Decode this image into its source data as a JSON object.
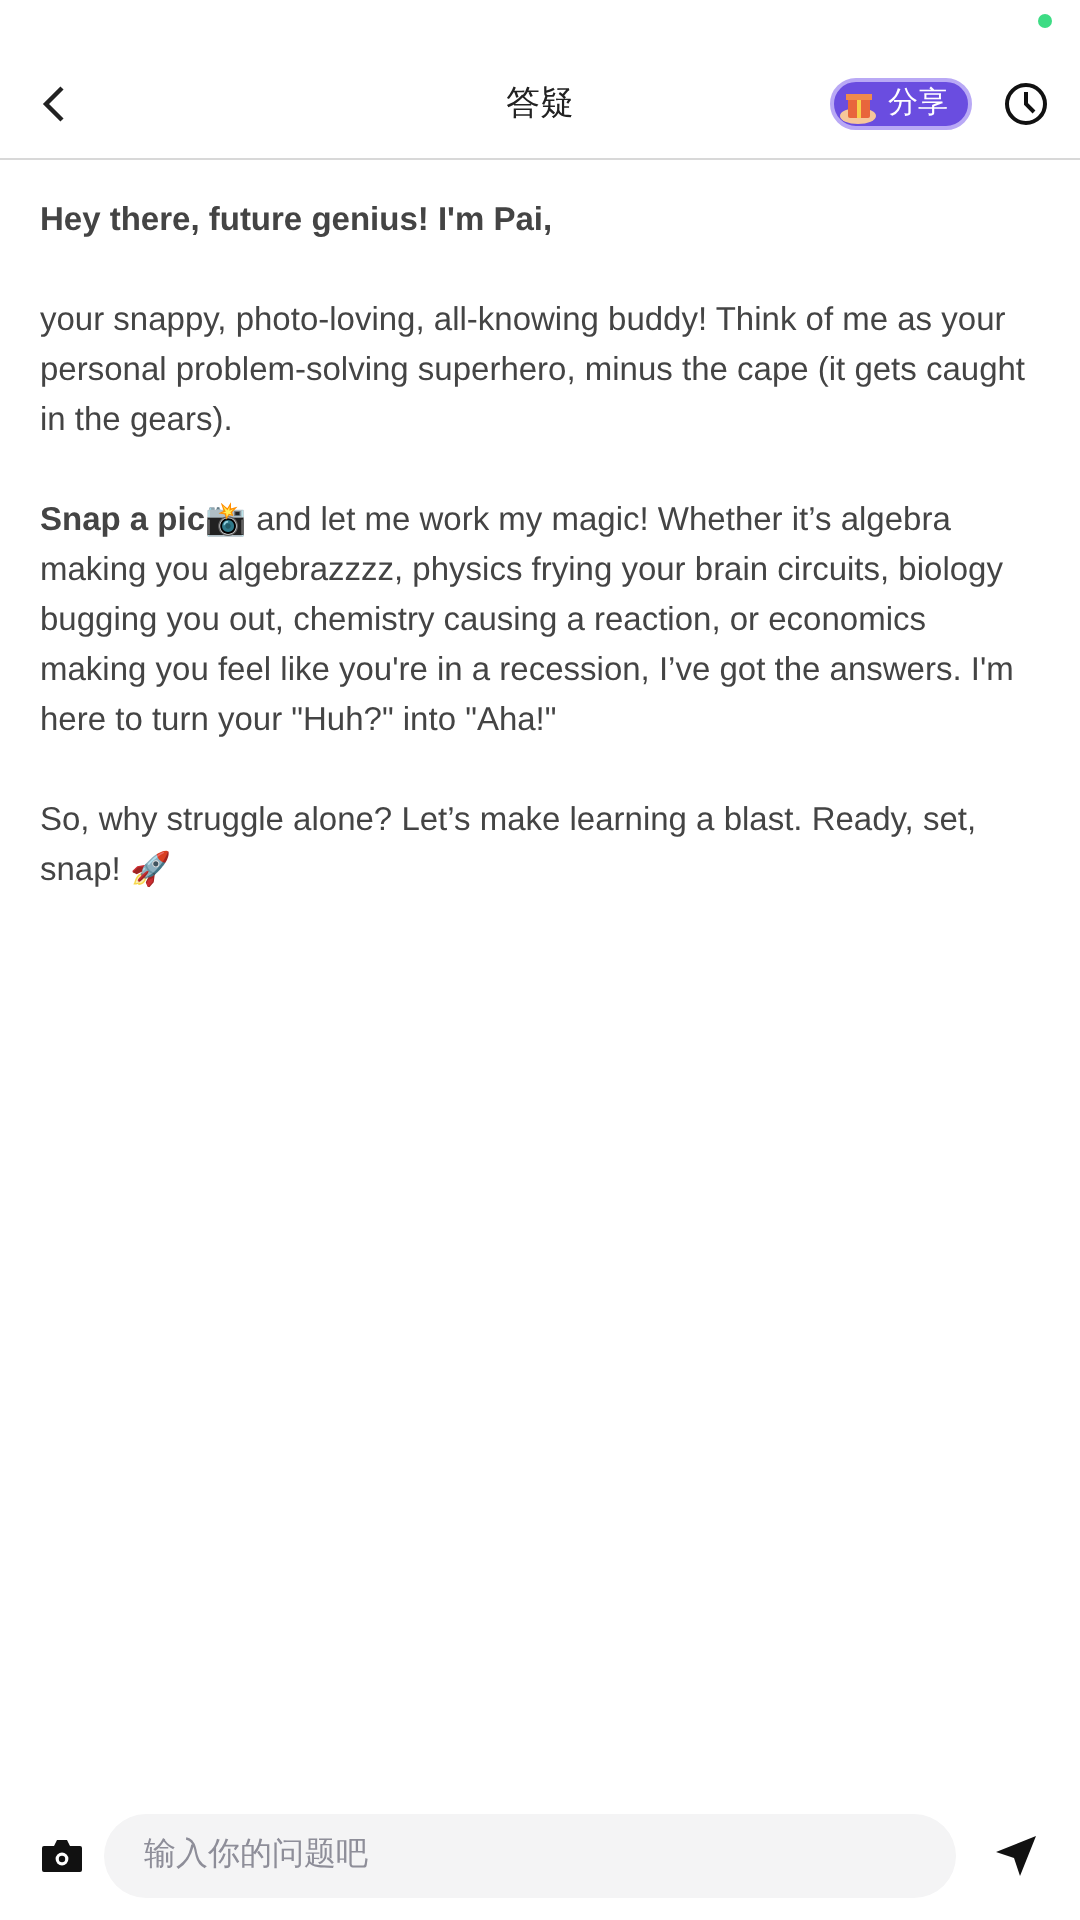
{
  "header": {
    "title": "答疑",
    "share_button": "分享"
  },
  "message": {
    "greeting": "Hey there, future genius!  I'm Pai,",
    "paragraphs": [
      "your snappy, photo-loving, all-knowing buddy! Think of me as your personal problem-solving superhero, minus the cape (it gets caught in the gears).",
      "**Snap a pic**📸 and let me work my magic! Whether it’s algebra making you algebrazzzz, physics frying your brain circuits, biology bugging you out, chemistry causing a reaction, or economics making you feel like you're in a recession, I’ve got the answers. I'm here to turn your \"Huh?\" into \"Aha!\"",
      "So, why struggle alone? Let’s make learning a blast. Ready, set, snap! 🚀"
    ]
  },
  "input": {
    "placeholder": "输入你的问题吧"
  }
}
